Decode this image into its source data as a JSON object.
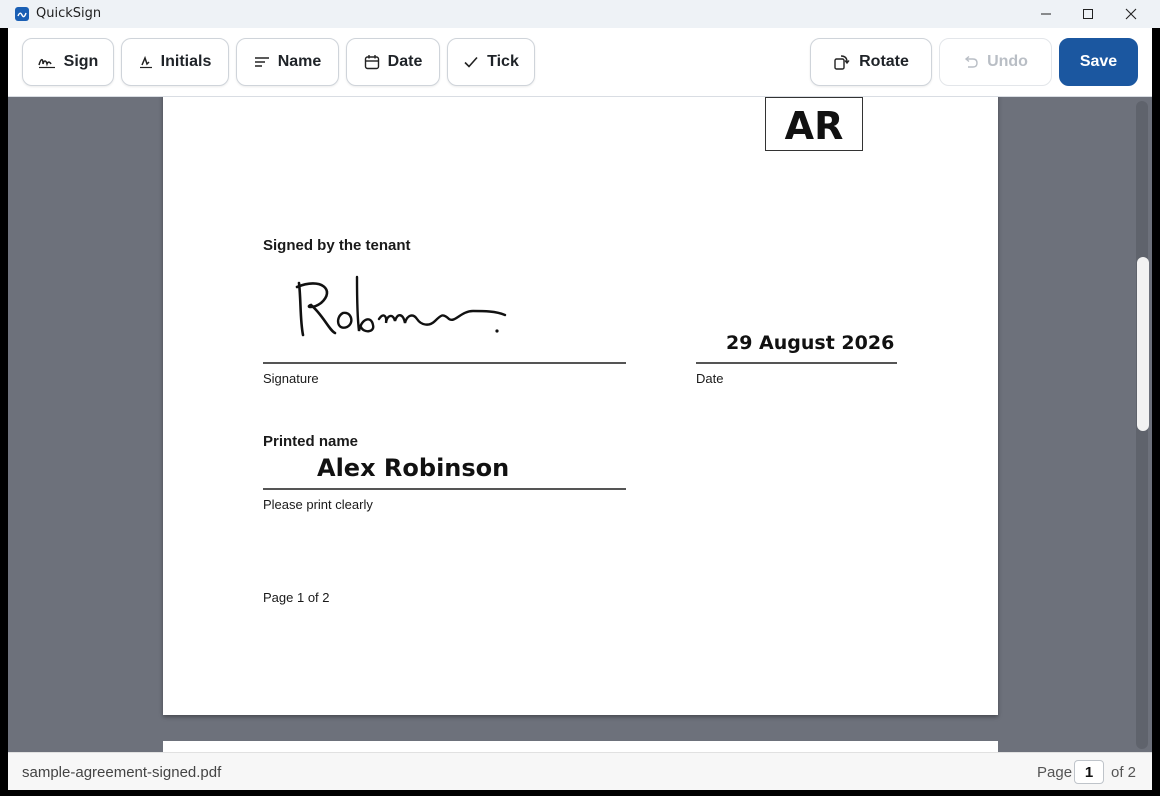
{
  "app": {
    "title": "QuickSign"
  },
  "toolbar": {
    "sign_label": "Sign",
    "initials_label": "Initials",
    "name_label": "Name",
    "date_label": "Date",
    "tick_label": "Tick",
    "rotate_label": "Rotate",
    "undo_label": "Undo",
    "save_label": "Save"
  },
  "document": {
    "initials_stamp": "AR",
    "section_heading": "Signed by the tenant",
    "signature_label": "Signature",
    "date_value": "29 August 2026",
    "date_label": "Date",
    "printed_name_heading": "Printed name",
    "printed_name_value": "Alex Robinson",
    "print_hint": "Please print clearly",
    "page_footer": "Page 1 of 2"
  },
  "status": {
    "filename": "sample-agreement-signed.pdf",
    "page_label": "Page",
    "current_page": "1",
    "page_total": "of 2"
  },
  "colors": {
    "save_button": "#1b57a0",
    "viewer_background": "#6d717b"
  },
  "icons": [
    "signature-icon",
    "initials-icon",
    "name-lines-icon",
    "calendar-icon",
    "check-icon",
    "rotate-icon",
    "undo-icon"
  ]
}
